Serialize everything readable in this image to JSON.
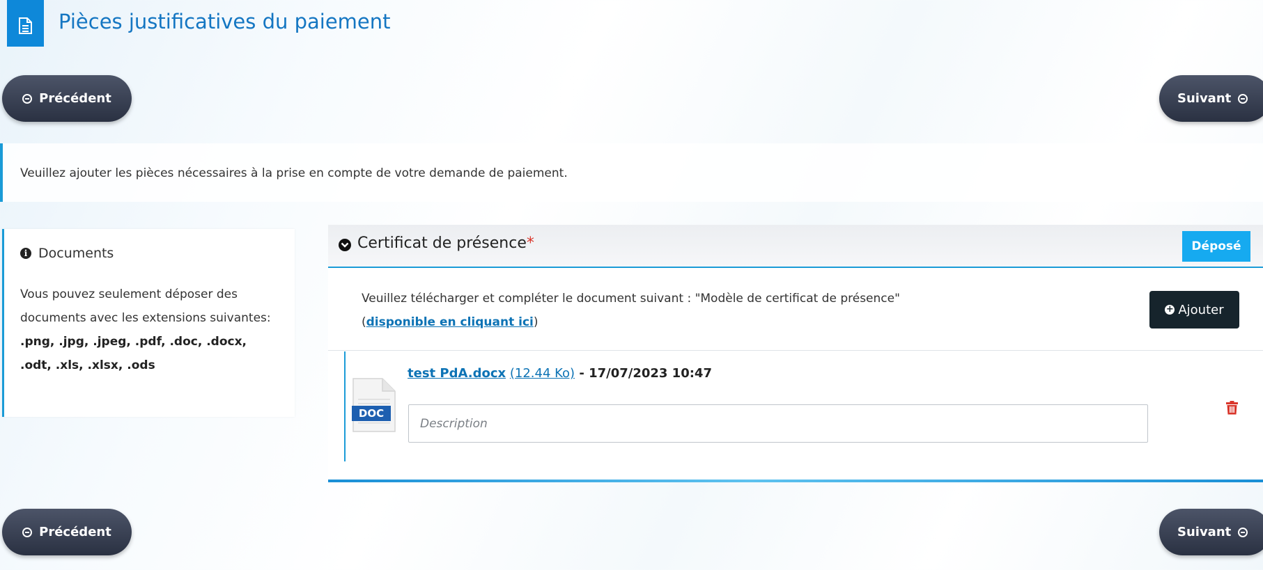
{
  "header": {
    "title": "Pièces justificatives du paiement",
    "icon": "document-icon"
  },
  "nav": {
    "prev_label": "Précédent",
    "next_label": "Suivant"
  },
  "info_message": "Veuillez ajouter les pièces nécessaires à la prise en compte de votre demande de paiement.",
  "documents_card": {
    "title": "Documents",
    "text": "Vous pouvez seulement déposer des documents avec les extensions suivantes:",
    "extensions": ".png, .jpg, .jpeg, .pdf, .doc, .docx, .odt, .xls, .xlsx, .ods"
  },
  "section": {
    "title": "Certificat de présence",
    "required_mark": "*",
    "status_badge": "Déposé",
    "instruction": "Veuillez télécharger et compléter le document suivant : \"Modèle de certificat de présence\" (",
    "instruction_link": "disponible en cliquant ici",
    "instruction_end": ")",
    "add_label": "Ajouter",
    "file": {
      "name": "test PdA.docx",
      "size": "(12.44 Ko)",
      "date": " - 17/07/2023 10:47",
      "icon_label": "DOC"
    },
    "description_placeholder": "Description"
  },
  "colors": {
    "accent": "#1a9bd7",
    "title": "#1476c2",
    "badge": "#16aaf0",
    "nav_button": "#2a3142",
    "add_button": "#16242c",
    "delete": "#d9362b"
  }
}
